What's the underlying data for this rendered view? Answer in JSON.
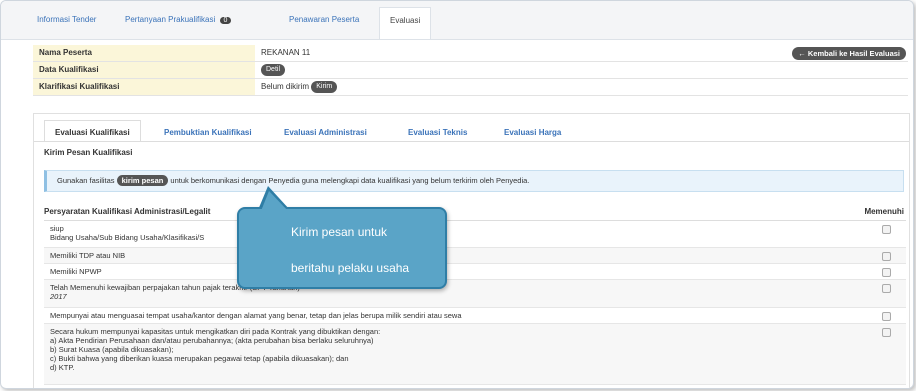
{
  "top_tabs": [
    {
      "label": "Informasi Tender"
    },
    {
      "label": "Pertanyaan Prakualifikasi",
      "badge": "0"
    },
    {
      "label": "Penawaran Peserta"
    },
    {
      "label": "Evaluasi"
    }
  ],
  "info": {
    "peserta_label": "Nama Peserta",
    "peserta_value": "REKANAN 11",
    "kualifikasi_label": "Data Kualifikasi",
    "detil_btn": "Detil",
    "klarifikasi_label": "Klarifikasi Kualifikasi",
    "klarifikasi_status": "Belum dikirim",
    "kirim_btn": "Kirim",
    "back_btn": "← Kembali ke Hasil Evaluasi"
  },
  "sub_tabs": [
    "Evaluasi Kualifikasi",
    "Pembuktian Kualifikasi",
    "Evaluasi Administrasi",
    "Evaluasi Teknis",
    "Evaluasi Harga"
  ],
  "section_title": "Kirim Pesan Kualifikasi",
  "notice": {
    "before": "Gunakan fasilitas",
    "pill": "kirim pesan",
    "after": "untuk berkomunikasi dengan Penyedia guna melengkapi data kualifikasi yang belum terkirim oleh Penyedia."
  },
  "table": {
    "header_left": "Persyaratan Kualifikasi Administrasi/Legalit",
    "header_right": "Memenuhi",
    "rows": [
      [
        "siup",
        "Bidang Usaha/Sub Bidang Usaha/Klasifikasi/S"
      ],
      [
        "Memiliki TDP atau NIB"
      ],
      [
        "Memiliki NPWP"
      ],
      [
        "Telah Memenuhi kewajiban perpajakan tahun pajak terakhir (SPT Tahunan)",
        "2017"
      ],
      [
        "Mempunyai atau menguasai tempat usaha/kantor dengan alamat yang benar, tetap dan jelas berupa milik sendiri atau sewa"
      ],
      [
        "Secara hukum mempunyai kapasitas untuk mengikatkan diri pada Kontrak yang dibuktikan dengan:",
        "a) Akta Pendirian Perusahaan dan/atau perubahannya; (akta perubahan bisa berlaku seluruhnya)",
        "b) Surat Kuasa (apabila dikuasakan);",
        "c) Bukti bahwa yang diberikan kuasa merupakan pegawai tetap (apabila dikuasakan); dan",
        "d) KTP."
      ]
    ]
  },
  "callout": {
    "line1": "Kirim pesan untuk",
    "line2": "beritahu pelaku usaha"
  }
}
